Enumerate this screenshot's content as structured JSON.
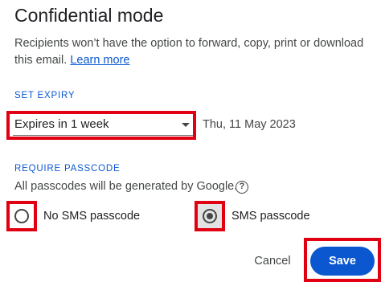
{
  "dialog": {
    "title": "Confidential mode",
    "description": "Recipients won’t have the option to forward, copy, print or download this email.",
    "learn_more": "Learn more"
  },
  "expiry": {
    "section_label": "SET EXPIRY",
    "selected_value": "Expires in 1 week",
    "expiry_date": "Thu, 11 May 2023"
  },
  "passcode": {
    "section_label": "REQUIRE PASSCODE",
    "hint": "All passcodes will be generated by Google.",
    "help_icon": "?",
    "options": [
      {
        "label": "No SMS passcode",
        "selected": false
      },
      {
        "label": "SMS passcode",
        "selected": true
      }
    ]
  },
  "actions": {
    "cancel_label": "Cancel",
    "save_label": "Save"
  },
  "colors": {
    "accent": "#0b57d0",
    "highlight": "#e00012"
  }
}
